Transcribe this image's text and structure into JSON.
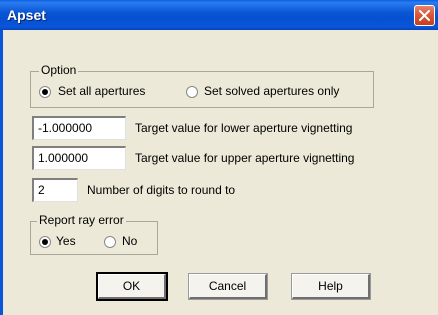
{
  "window": {
    "title": "Apset"
  },
  "option_group": {
    "legend": "Option",
    "radio_all_label": "Set all apertures",
    "radio_solved_label": "Set solved apertures only",
    "selected": "Set all apertures"
  },
  "fields": {
    "lower_value": "-1.000000",
    "lower_label": "Target value for lower aperture vignetting",
    "upper_value": "1.000000",
    "upper_label": "Target value for upper aperture vignetting",
    "digits_value": "2",
    "digits_label": "Number of digits to round to"
  },
  "report_group": {
    "legend": "Report ray error",
    "yes_label": "Yes",
    "no_label": "No",
    "selected": "Yes"
  },
  "buttons": {
    "ok": "OK",
    "cancel": "Cancel",
    "help": "Help"
  },
  "icons": {
    "close": "close-icon",
    "radio": "radio-icon"
  }
}
